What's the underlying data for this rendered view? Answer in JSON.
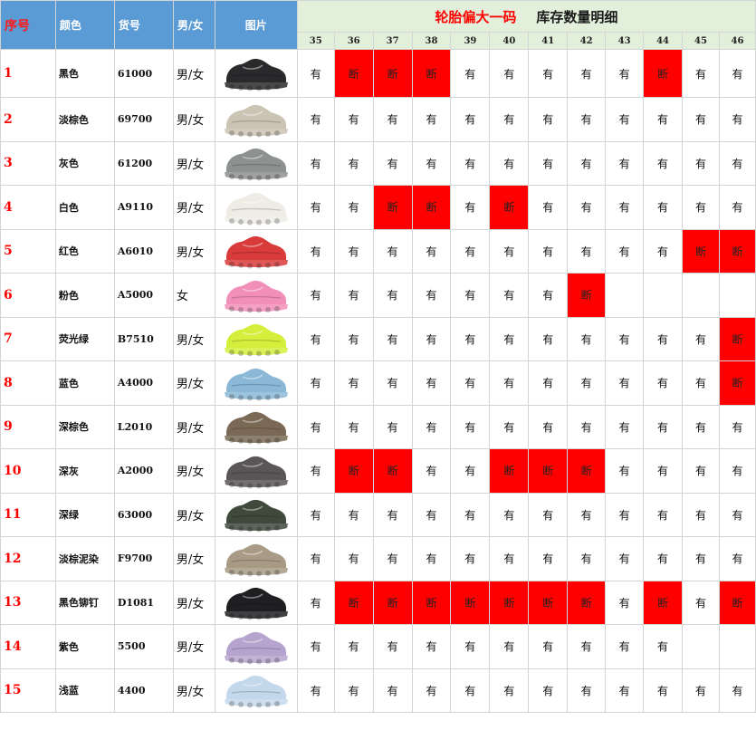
{
  "headers": {
    "seq": "序号",
    "color": "颜色",
    "code": "货号",
    "gender": "男/女",
    "picture": "图片",
    "title_red": "轮胎偏大一码",
    "title_dark": "库存数量明细"
  },
  "sizes": [
    "35",
    "36",
    "37",
    "38",
    "39",
    "40",
    "41",
    "42",
    "43",
    "44",
    "45",
    "46"
  ],
  "rows": [
    {
      "seq": "1",
      "color": "黑色",
      "code": "61000",
      "gender": "男/女",
      "shoe_color": "#2a2a2c",
      "stock": [
        "有",
        "断",
        "断",
        "断",
        "有",
        "有",
        "有",
        "有",
        "有",
        "断",
        "有",
        "有"
      ]
    },
    {
      "seq": "2",
      "color": "淡棕色",
      "code": "69700",
      "gender": "男/女",
      "shoe_color": "#cbc3b4",
      "stock": [
        "有",
        "有",
        "有",
        "有",
        "有",
        "有",
        "有",
        "有",
        "有",
        "有",
        "有",
        "有"
      ]
    },
    {
      "seq": "3",
      "color": "灰色",
      "code": "61200",
      "gender": "男/女",
      "shoe_color": "#8d918f",
      "stock": [
        "有",
        "有",
        "有",
        "有",
        "有",
        "有",
        "有",
        "有",
        "有",
        "有",
        "有",
        "有"
      ]
    },
    {
      "seq": "4",
      "color": "白色",
      "code": "A9110",
      "gender": "男/女",
      "shoe_color": "#efece6",
      "stock": [
        "有",
        "有",
        "断",
        "断",
        "有",
        "断",
        "有",
        "有",
        "有",
        "有",
        "有",
        "有"
      ]
    },
    {
      "seq": "5",
      "color": "红色",
      "code": "A6010",
      "gender": "男/女",
      "shoe_color": "#d93a3a",
      "stock": [
        "有",
        "有",
        "有",
        "有",
        "有",
        "有",
        "有",
        "有",
        "有",
        "有",
        "断",
        "断"
      ]
    },
    {
      "seq": "6",
      "color": "粉色",
      "code": "A5000",
      "gender": "女",
      "shoe_color": "#f28fb8",
      "stock": [
        "有",
        "有",
        "有",
        "有",
        "有",
        "有",
        "有",
        "断",
        "",
        "",
        "",
        ""
      ]
    },
    {
      "seq": "7",
      "color": "荧光绿",
      "code": "B7510",
      "gender": "男/女",
      "shoe_color": "#d4ee3c",
      "stock": [
        "有",
        "有",
        "有",
        "有",
        "有",
        "有",
        "有",
        "有",
        "有",
        "有",
        "有",
        "断"
      ]
    },
    {
      "seq": "8",
      "color": "蓝色",
      "code": "A4000",
      "gender": "男/女",
      "shoe_color": "#8ab8d6",
      "stock": [
        "有",
        "有",
        "有",
        "有",
        "有",
        "有",
        "有",
        "有",
        "有",
        "有",
        "有",
        "断"
      ]
    },
    {
      "seq": "9",
      "color": "深棕色",
      "code": "L2010",
      "gender": "男/女",
      "shoe_color": "#7a6a55",
      "stock": [
        "有",
        "有",
        "有",
        "有",
        "有",
        "有",
        "有",
        "有",
        "有",
        "有",
        "有",
        "有"
      ]
    },
    {
      "seq": "10",
      "color": "深灰",
      "code": "A2000",
      "gender": "男/女",
      "shoe_color": "#5a5658",
      "stock": [
        "有",
        "断",
        "断",
        "有",
        "有",
        "断",
        "断",
        "断",
        "有",
        "有",
        "有",
        "有"
      ]
    },
    {
      "seq": "11",
      "color": "深绿",
      "code": "63000",
      "gender": "男/女",
      "shoe_color": "#3f4a3c",
      "stock": [
        "有",
        "有",
        "有",
        "有",
        "有",
        "有",
        "有",
        "有",
        "有",
        "有",
        "有",
        "有"
      ]
    },
    {
      "seq": "12",
      "color": "淡棕泥染",
      "code": "F9700",
      "gender": "男/女",
      "shoe_color": "#a89a85",
      "stock": [
        "有",
        "有",
        "有",
        "有",
        "有",
        "有",
        "有",
        "有",
        "有",
        "有",
        "有",
        "有"
      ]
    },
    {
      "seq": "13",
      "color": "黑色铆钉",
      "code": "D1081",
      "gender": "男/女",
      "shoe_color": "#1f1f22",
      "stock": [
        "有",
        "断",
        "断",
        "断",
        "断",
        "断",
        "断",
        "断",
        "有",
        "断",
        "有",
        "断"
      ]
    },
    {
      "seq": "14",
      "color": "紫色",
      "code": "5500",
      "gender": "男/女",
      "shoe_color": "#b6a4cf",
      "stock": [
        "有",
        "有",
        "有",
        "有",
        "有",
        "有",
        "有",
        "有",
        "有",
        "有",
        "",
        ""
      ]
    },
    {
      "seq": "15",
      "color": "浅蓝",
      "code": "4400",
      "gender": "男/女",
      "shoe_color": "#c4d8ec",
      "stock": [
        "有",
        "有",
        "有",
        "有",
        "有",
        "有",
        "有",
        "有",
        "有",
        "有",
        "有",
        "有"
      ]
    }
  ]
}
